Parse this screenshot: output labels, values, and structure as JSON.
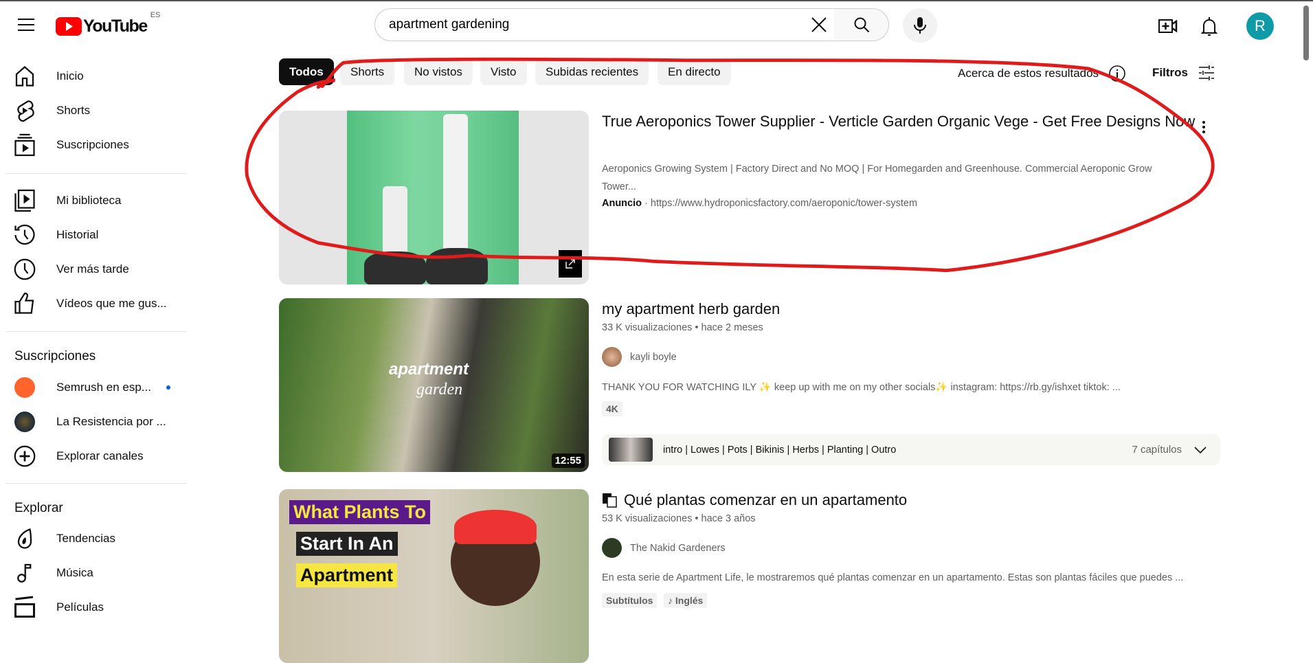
{
  "header": {
    "logo_text": "YouTube",
    "region": "ES",
    "search_value": "apartment gardening",
    "avatar_letter": "R",
    "icons": [
      "menu-icon",
      "search-icon",
      "clear-icon",
      "mic-icon",
      "create-icon",
      "bell-icon"
    ]
  },
  "sidebar": {
    "items": [
      {
        "label": "Inicio",
        "icon": "home-icon"
      },
      {
        "label": "Shorts",
        "icon": "shorts-icon"
      },
      {
        "label": "Suscripciones",
        "icon": "subscriptions-icon"
      }
    ],
    "library": [
      {
        "label": "Mi biblioteca",
        "icon": "library-icon"
      },
      {
        "label": "Historial",
        "icon": "history-icon"
      },
      {
        "label": "Ver más tarde",
        "icon": "clock-icon"
      },
      {
        "label": "Vídeos que me gus...",
        "icon": "thumbs-up-icon"
      }
    ],
    "subs_heading": "Suscripciones",
    "subs": [
      {
        "label": "Semrush en esp...",
        "color": "#ff642d",
        "new": true
      },
      {
        "label": "La Resistencia por ...",
        "color": "#1b2a3a",
        "new": false
      }
    ],
    "explore_channels": "Explorar canales",
    "explore_heading": "Explorar",
    "explore": [
      {
        "label": "Tendencias",
        "icon": "trending-icon"
      },
      {
        "label": "Música",
        "icon": "music-icon"
      },
      {
        "label": "Películas",
        "icon": "movies-icon"
      }
    ]
  },
  "chips": [
    "Todos",
    "Shorts",
    "No vistos",
    "Visto",
    "Subidas recientes",
    "En directo"
  ],
  "about_results": "Acerca de estos resultados",
  "filters": "Filtros",
  "ad": {
    "title": "True Aeroponics Tower Supplier - Verticle Garden Organic Vege - Get Free Designs Now",
    "description": "Aeroponics Growing System | Factory Direct and No MOQ | For Homegarden and Greenhouse. Commercial Aeroponic Grow Tower...",
    "label": "Anuncio",
    "url": "https://www.hydroponicsfactory.com/aeroponic/tower-system"
  },
  "videos": [
    {
      "title": "my apartment herb garden",
      "views": "33 K visualizaciones",
      "age": "hace 2 meses",
      "channel": "kayli boyle",
      "description": "THANK YOU FOR WATCHING ILY ✨ keep up with me on my other socials✨ instagram: https://rb.gy/ishxet tiktok: ...",
      "badges": [
        "4K"
      ],
      "duration": "12:55",
      "thumb_text": [
        "apartment",
        "garden"
      ],
      "chapters": "intro | Lowes | Pots | Bikinis | Herbs | Planting | Outro",
      "chapters_count": "7 capítulos"
    },
    {
      "title": "Qué plantas comenzar en un apartamento",
      "views": "53 K visualizaciones",
      "age": "hace 3 años",
      "channel": "The Nakid Gardeners",
      "description": "En esta serie de Apartment Life, le mostraremos qué plantas comenzar en un apartamento. Estas son plantas fáciles que puedes ...",
      "badges": [
        "Subtítulos",
        "Inglés"
      ],
      "thumb_text": [
        "What Plants To",
        "Start In An",
        "Apartment"
      ]
    }
  ],
  "annotation_color": "#e01b1b"
}
